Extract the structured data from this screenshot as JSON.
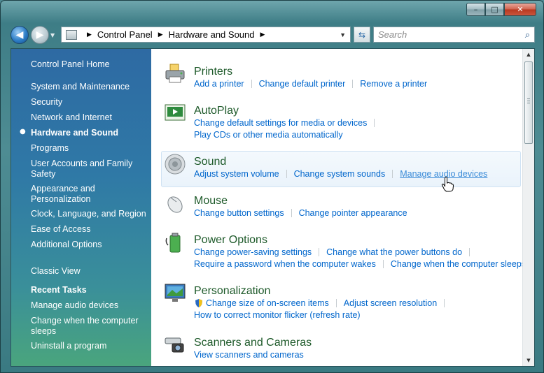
{
  "window": {
    "caption": {
      "minimize": "–",
      "maximize": "□",
      "close": "✕"
    }
  },
  "navbar": {
    "address": {
      "root_label": "Control Panel",
      "current_label": "Hardware and Sound"
    },
    "search": {
      "placeholder": "Search"
    }
  },
  "sidebar": {
    "home": "Control Panel Home",
    "items": [
      {
        "label": "System and Maintenance"
      },
      {
        "label": "Security"
      },
      {
        "label": "Network and Internet"
      },
      {
        "label": "Hardware and Sound",
        "active": true
      },
      {
        "label": "Programs"
      },
      {
        "label": "User Accounts and Family Safety"
      },
      {
        "label": "Appearance and Personalization"
      },
      {
        "label": "Clock, Language, and Region"
      },
      {
        "label": "Ease of Access"
      },
      {
        "label": "Additional Options"
      }
    ],
    "classic_view": "Classic View",
    "recent_heading": "Recent Tasks",
    "recent": [
      {
        "label": "Manage audio devices"
      },
      {
        "label": "Change when the computer sleeps"
      },
      {
        "label": "Uninstall a program"
      }
    ]
  },
  "categories": [
    {
      "title": "Printers",
      "rows": [
        [
          "Add a printer",
          "Change default printer",
          "Remove a printer"
        ]
      ]
    },
    {
      "title": "AutoPlay",
      "rows": [
        [
          "Change default settings for media or devices"
        ],
        [
          "Play CDs or other media automatically"
        ]
      ]
    },
    {
      "title": "Sound",
      "rows": [
        [
          "Adjust system volume",
          "Change system sounds",
          "Manage audio devices"
        ]
      ]
    },
    {
      "title": "Mouse",
      "rows": [
        [
          "Change button settings",
          "Change pointer appearance"
        ]
      ]
    },
    {
      "title": "Power Options",
      "rows": [
        [
          "Change power-saving settings",
          "Change what the power buttons do"
        ],
        [
          "Require a password when the computer wakes",
          "Change when the computer sleeps"
        ]
      ]
    },
    {
      "title": "Personalization",
      "rows": [
        [
          "Change size of on-screen items",
          "Adjust screen resolution"
        ],
        [
          "How to correct monitor flicker (refresh rate)"
        ]
      ]
    },
    {
      "title": "Scanners and Cameras",
      "rows": [
        [
          "View scanners and cameras"
        ]
      ]
    }
  ],
  "icons": {
    "printers": "printer-icon",
    "autoplay": "autoplay-icon",
    "sound": "speaker-icon",
    "mouse": "mouse-icon",
    "power": "battery-icon",
    "personalization": "monitor-icon",
    "scanners": "scanner-icon"
  },
  "colors": {
    "link": "#0066cc",
    "category_title": "#1e5a2a",
    "sidebar_top": "#2e6aa3",
    "sidebar_bottom": "#4aa57d"
  }
}
